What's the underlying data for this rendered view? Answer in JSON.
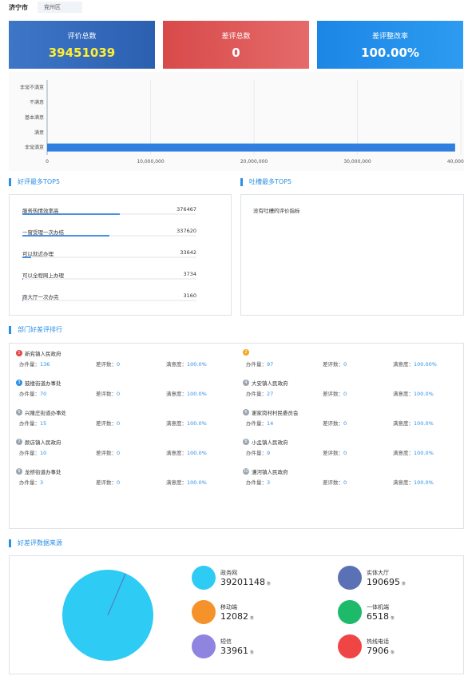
{
  "header": {
    "city": "济宁市",
    "district": "兖州区"
  },
  "cards": [
    {
      "title": "评价总数",
      "value": "39451039"
    },
    {
      "title": "差评总数",
      "value": "0"
    },
    {
      "title": "差评整改率",
      "value": "100.00%"
    }
  ],
  "chart_data": {
    "type": "bar",
    "orientation": "horizontal",
    "categories": [
      "非常不满意",
      "不满意",
      "基本满意",
      "满意",
      "非常满意"
    ],
    "values": [
      0,
      0,
      0,
      0,
      39451039
    ],
    "xlim": [
      0,
      40000000
    ],
    "xticks": [
      "0",
      "10,000,000",
      "20,000,000",
      "30,000,000",
      "40,000,000"
    ],
    "color": "#2f7fe0",
    "grid": true
  },
  "good_top5": {
    "title": "好评最多TOP5",
    "items": [
      {
        "name": "服务热情效率高",
        "value": "376467",
        "ratio": 0.56
      },
      {
        "name": "一窗受理一次办结",
        "value": "337620",
        "ratio": 0.5
      },
      {
        "name": "可以就近办理",
        "value": "33642",
        "ratio": 0.05
      },
      {
        "name": "可以全程网上办理",
        "value": "3734",
        "ratio": 0.006
      },
      {
        "name": "跑大厅一次办完",
        "value": "3160",
        "ratio": 0.005
      }
    ]
  },
  "bad_top5": {
    "title": "吐槽最多TOP5",
    "empty_text": "没有吐槽的评价指标"
  },
  "dept_rank": {
    "title": "部门好差评排行",
    "labels": {
      "handled": "办件量：",
      "bad": "差评数：",
      "satisfaction": "满意度："
    },
    "items": [
      {
        "rank": "1",
        "name": "新兖镇人民政府",
        "handled": "136",
        "bad": "0",
        "satisfaction": "100.0%",
        "color": "#e64545"
      },
      {
        "rank": "2",
        "name": "",
        "handled": "97",
        "bad": "0",
        "satisfaction": "100.00%",
        "color": "#f5a623"
      },
      {
        "rank": "3",
        "name": "鼓楼街道办事处",
        "handled": "70",
        "bad": "0",
        "satisfaction": "100.0%",
        "color": "#2b8fe6"
      },
      {
        "rank": "4",
        "name": "大安镇人民政府",
        "handled": "27",
        "bad": "0",
        "satisfaction": "100.0%",
        "color": "#9aa5b1"
      },
      {
        "rank": "5",
        "name": "兴隆庄街道办事处",
        "handled": "15",
        "bad": "0",
        "satisfaction": "100.0%",
        "color": "#9aa5b1"
      },
      {
        "rank": "6",
        "name": "谢家岗村村民委员会",
        "handled": "14",
        "bad": "0",
        "satisfaction": "100.0%",
        "color": "#9aa5b1"
      },
      {
        "rank": "7",
        "name": "颜店镇人民政府",
        "handled": "10",
        "bad": "0",
        "satisfaction": "100.0%",
        "color": "#9aa5b1"
      },
      {
        "rank": "8",
        "name": "小孟镇人民政府",
        "handled": "9",
        "bad": "0",
        "satisfaction": "100.0%",
        "color": "#9aa5b1"
      },
      {
        "rank": "9",
        "name": "龙桥街道办事处",
        "handled": "3",
        "bad": "0",
        "satisfaction": "100.0%",
        "color": "#9aa5b1"
      },
      {
        "rank": "10",
        "name": "漕河镇人民政府",
        "handled": "3",
        "bad": "0",
        "satisfaction": "100.0%",
        "color": "#9aa5b1"
      }
    ]
  },
  "sources": {
    "title": "好差评数据来源",
    "unit": "条",
    "items": [
      {
        "name": "政务网",
        "value": "39201148",
        "color": "#2ecbf5"
      },
      {
        "name": "实体大厅",
        "value": "190695",
        "color": "#5a72b5"
      },
      {
        "name": "移动端",
        "value": "12082",
        "color": "#f5922a"
      },
      {
        "name": "一体机端",
        "value": "6518",
        "color": "#1dba6a"
      },
      {
        "name": "短信",
        "value": "33961",
        "color": "#8f84e0"
      },
      {
        "name": "热线电话",
        "value": "7906",
        "color": "#f04545"
      }
    ]
  }
}
